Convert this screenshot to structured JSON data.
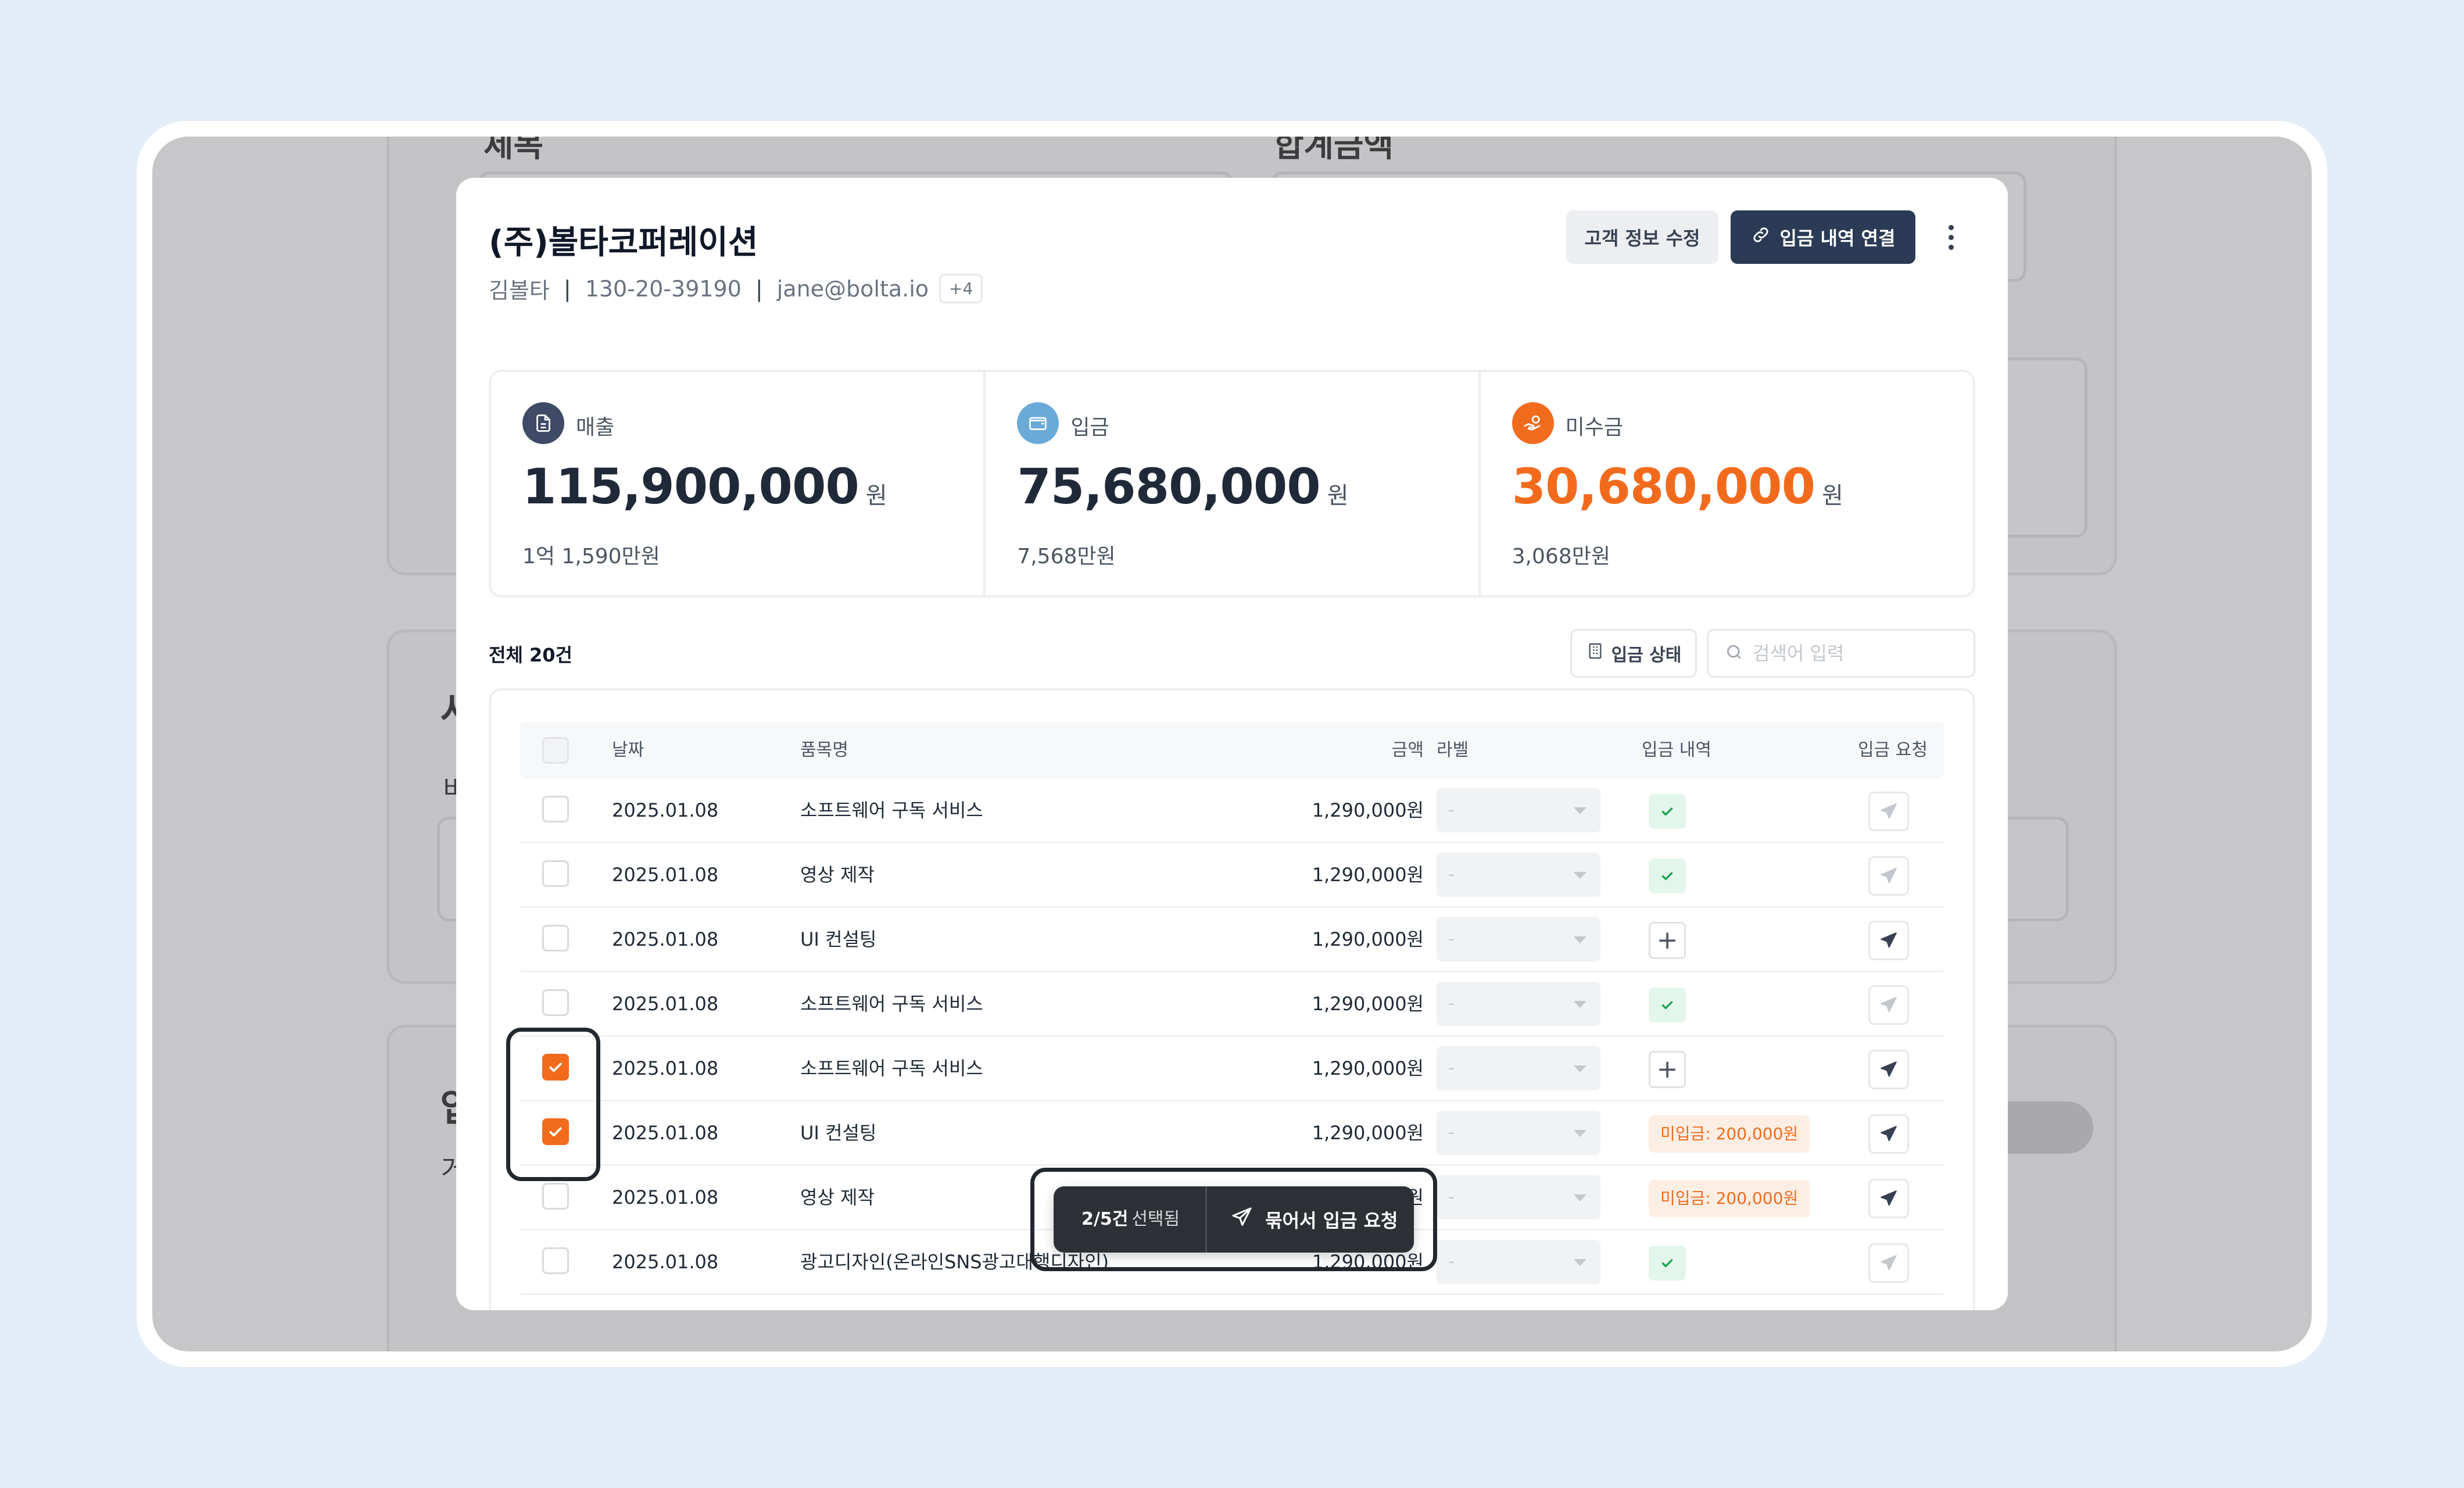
{
  "background": {
    "label_top_left": "제목",
    "label_top_right": "합계금액",
    "label_mid": "서",
    "label_mid_sub": "비",
    "label_low": "입",
    "label_low_sub": "거"
  },
  "customer": {
    "name": "(주)볼타코퍼레이션",
    "contact_name": "김볼타",
    "biz_number": "130-20-39190",
    "email": "jane@bolta.io",
    "extra_count": "+4"
  },
  "actions": {
    "edit_label": "고객 정보 수정",
    "link_label": "입금 내역 연결"
  },
  "stats": [
    {
      "label": "매출",
      "value": "115,900,000",
      "unit": "원",
      "sub": "1억 1,590만원",
      "icon": "document-icon",
      "color": "#3e4a66"
    },
    {
      "label": "입금",
      "value": "75,680,000",
      "unit": "원",
      "sub": "7,568만원",
      "icon": "wallet-icon",
      "color": "#6aaad8"
    },
    {
      "label": "미수금",
      "value": "30,680,000",
      "unit": "원",
      "sub": "3,068만원",
      "icon": "hand-coin-icon",
      "color": "#f26b1d"
    }
  ],
  "list": {
    "total": "전체 20건",
    "status_filter": "입금 상태",
    "search_placeholder": "검색어 입력"
  },
  "table": {
    "headers": {
      "date": "날짜",
      "item": "품목명",
      "amount": "금액",
      "label": "라벨",
      "payment": "입금 내역",
      "request": "입금 요청"
    },
    "rows": [
      {
        "date": "2025.01.08",
        "item": "소프트웨어 구독 서비스",
        "amount": "1,290,000원",
        "label": "-",
        "checked": false,
        "payment": "ok",
        "send_active": false
      },
      {
        "date": "2025.01.08",
        "item": "영상 제작",
        "amount": "1,290,000원",
        "label": "-",
        "checked": false,
        "payment": "ok",
        "send_active": false
      },
      {
        "date": "2025.01.08",
        "item": "UI 컨설팅",
        "amount": "1,290,000원",
        "label": "-",
        "checked": false,
        "payment": "add",
        "send_active": true
      },
      {
        "date": "2025.01.08",
        "item": "소프트웨어 구독 서비스",
        "amount": "1,290,000원",
        "label": "-",
        "checked": false,
        "payment": "ok",
        "send_active": false
      },
      {
        "date": "2025.01.08",
        "item": "소프트웨어 구독 서비스",
        "amount": "1,290,000원",
        "label": "-",
        "checked": true,
        "payment": "add",
        "send_active": true
      },
      {
        "date": "2025.01.08",
        "item": "UI 컨설팅",
        "amount": "1,290,000원",
        "label": "-",
        "checked": true,
        "payment": "미입금: 200,000원",
        "send_active": true
      },
      {
        "date": "2025.01.08",
        "item": "영상 제작",
        "amount": "1,290,000원",
        "label": "-",
        "checked": false,
        "payment": "미입금: 200,000원",
        "send_active": true
      },
      {
        "date": "2025.01.08",
        "item": "광고디자인(온라인SNS광고대행디자인)",
        "amount": "1,290,000원",
        "label": "-",
        "checked": false,
        "payment": "ok",
        "send_active": false
      }
    ]
  },
  "selection_bar": {
    "count": "2/5건",
    "count_suffix": "선택됨",
    "action_label": "묶어서 입금 요청"
  },
  "colors": {
    "accent": "#f26b1d",
    "primary": "#2b3a55",
    "success": "#16a34a"
  }
}
